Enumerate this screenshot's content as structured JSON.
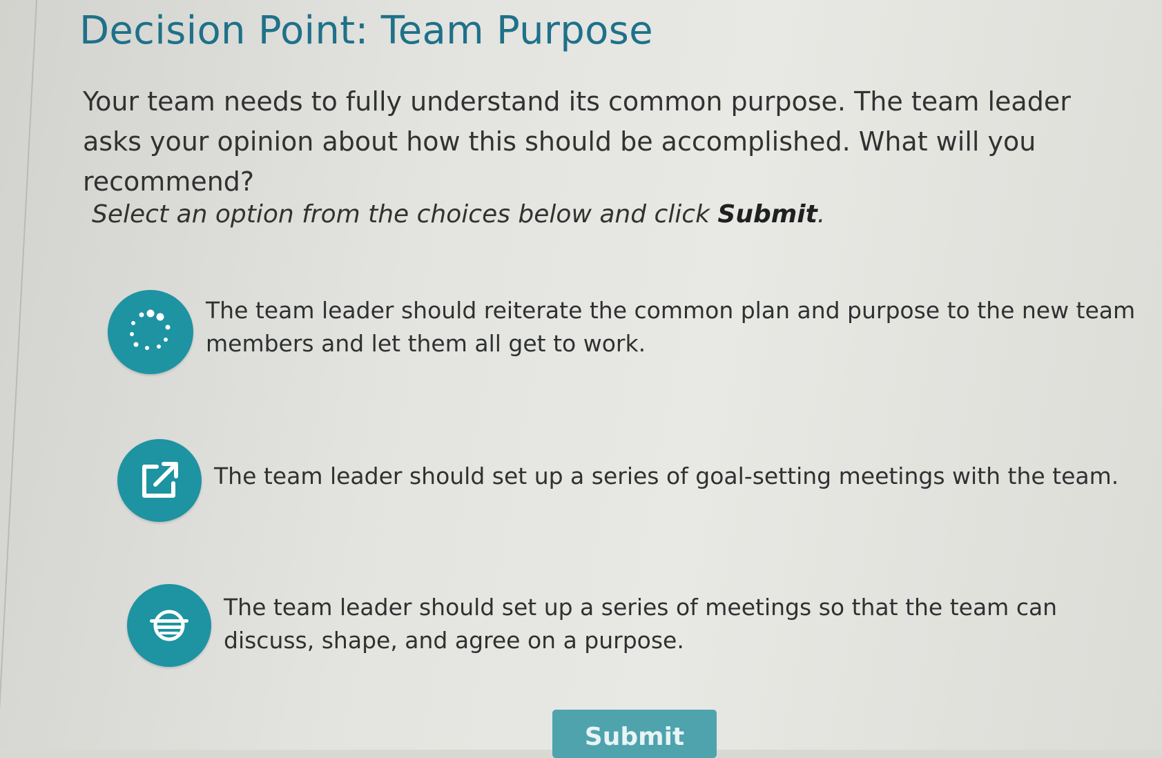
{
  "title": "Decision Point: Team Purpose",
  "question": "Your team needs to fully understand its common purpose. The team leader asks your opinion about how this should be accomplished. What will you recommend?",
  "instruction": {
    "prefix": "Select an option from the choices below and click ",
    "emphasis": "Submit",
    "suffix": "."
  },
  "options": [
    {
      "icon": "dots-circle-icon",
      "text": "The team leader should reiterate the common plan and purpose to the new team members and let them all get to work."
    },
    {
      "icon": "external-link-icon",
      "text": "The team leader should set up a series of goal-setting meetings with the team."
    },
    {
      "icon": "discussion-icon",
      "text": "The team leader should set up a series of meetings so that the team can discuss, shape, and agree on a purpose."
    }
  ],
  "submit_label": "Submit",
  "colors": {
    "title": "#1e7189",
    "icon_background": "#1e93a2",
    "submit_background": "#4ea3ad"
  }
}
